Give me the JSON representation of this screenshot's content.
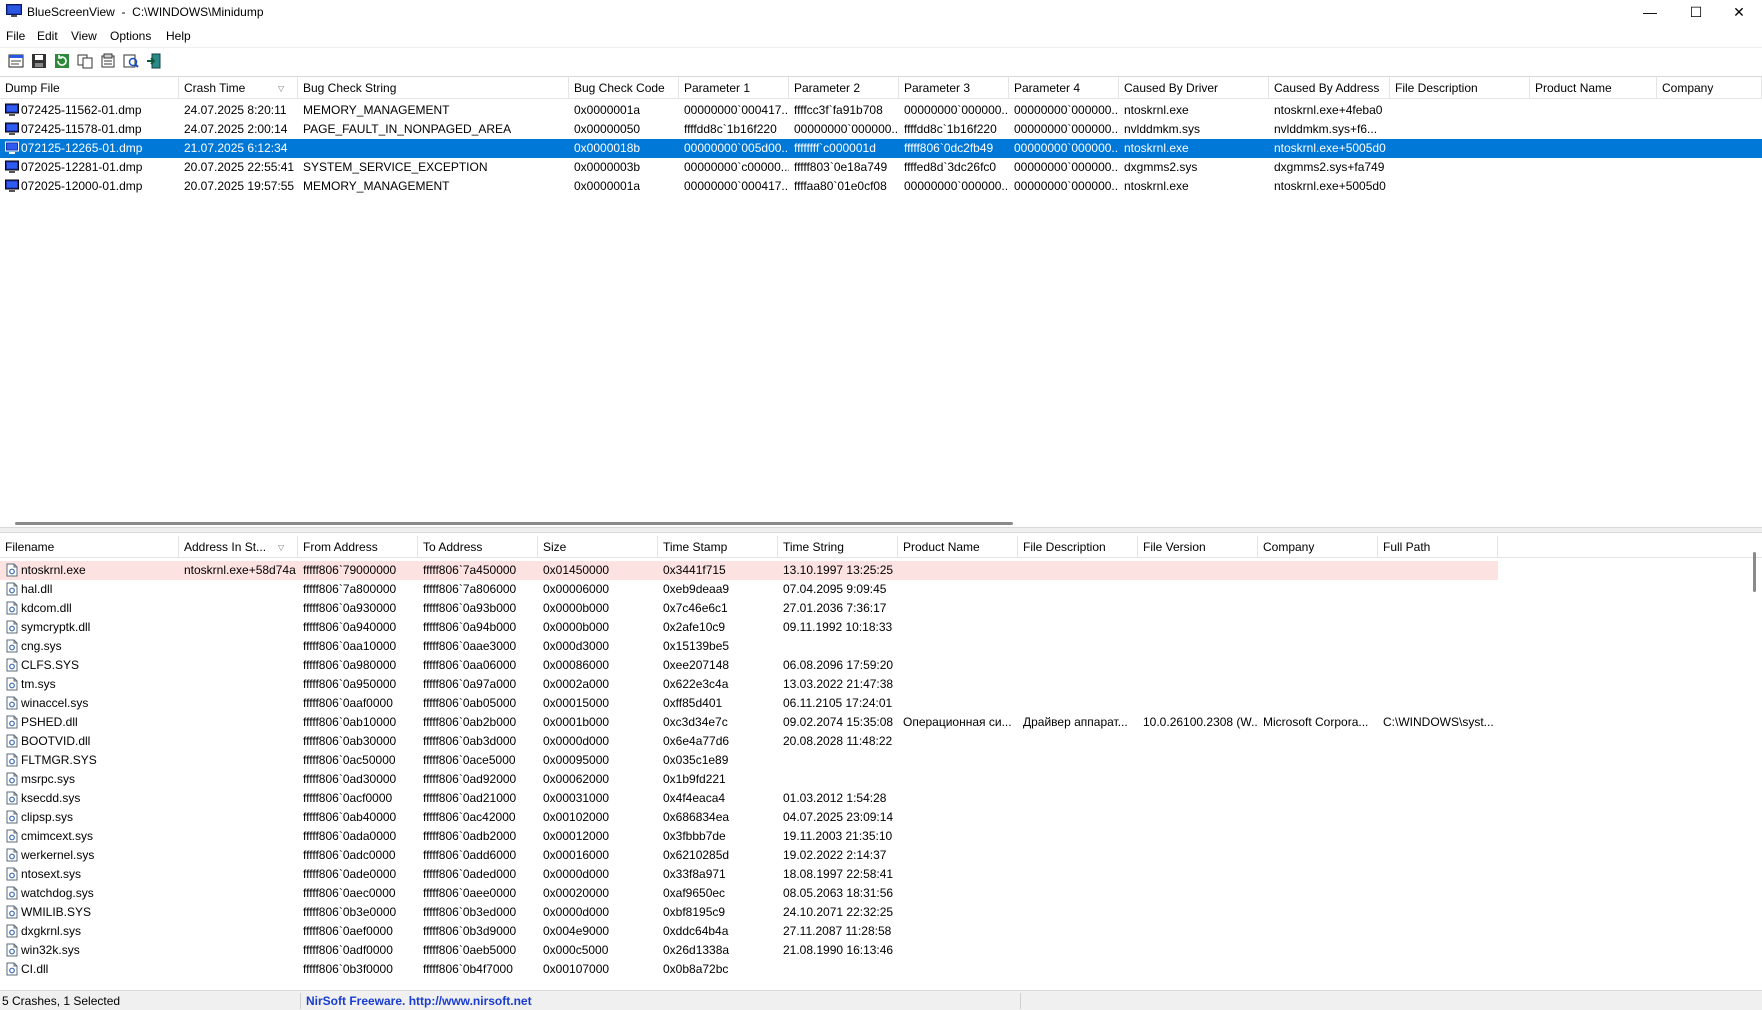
{
  "window": {
    "title": "BlueScreenView  -  C:\\WINDOWS\\Minidump",
    "minimize_glyph": "—",
    "maximize_glyph": "☐",
    "close_glyph": "✕"
  },
  "menu": [
    "File",
    "Edit",
    "View",
    "Options",
    "Help"
  ],
  "toolbar": [
    "html-report-icon",
    "save-icon",
    "refresh-icon",
    "copy-icon",
    "properties-icon",
    "find-icon",
    "exit-icon"
  ],
  "top_table": {
    "headers": [
      "Dump File",
      "Crash Time",
      "Bug Check String",
      "Bug Check Code",
      "Parameter 1",
      "Parameter 2",
      "Parameter 3",
      "Parameter 4",
      "Caused By Driver",
      "Caused By Address",
      "File Description",
      "Product Name",
      "Company"
    ],
    "rows": [
      [
        "072425-11562-01.dmp",
        "24.07.2025 8:20:11",
        "MEMORY_MANAGEMENT",
        "0x0000001a",
        "00000000`000417...",
        "ffffcc3f`fa91b708",
        "00000000`000000...",
        "00000000`000000...",
        "ntoskrnl.exe",
        "ntoskrnl.exe+4feba0",
        "",
        "",
        ""
      ],
      [
        "072425-11578-01.dmp",
        "24.07.2025 2:00:14",
        "PAGE_FAULT_IN_NONPAGED_AREA",
        "0x00000050",
        "ffffdd8c`1b16f220",
        "00000000`000000...",
        "ffffdd8c`1b16f220",
        "00000000`000000...",
        "nvlddmkm.sys",
        "nvlddmkm.sys+f6...",
        "",
        "",
        ""
      ],
      [
        "072125-12265-01.dmp",
        "21.07.2025 6:12:34",
        "",
        "0x0000018b",
        "00000000`005d00...",
        "ffffffff`c000001d",
        "fffff806`0dc2fb49",
        "00000000`000000...",
        "ntoskrnl.exe",
        "ntoskrnl.exe+5005d0",
        "",
        "",
        ""
      ],
      [
        "072025-12281-01.dmp",
        "20.07.2025 22:55:41",
        "SYSTEM_SERVICE_EXCEPTION",
        "0x0000003b",
        "00000000`c00000...",
        "fffff803`0e18a749",
        "ffffed8d`3dc26fc0",
        "00000000`000000...",
        "dxgmms2.sys",
        "dxgmms2.sys+fa749",
        "",
        "",
        ""
      ],
      [
        "072025-12000-01.dmp",
        "20.07.2025 19:57:55",
        "MEMORY_MANAGEMENT",
        "0x0000001a",
        "00000000`000417...",
        "ffffaa80`01e0cf08",
        "00000000`000000...",
        "00000000`000000...",
        "ntoskrnl.exe",
        "ntoskrnl.exe+5005d0",
        "",
        "",
        ""
      ]
    ],
    "selected_row": 2
  },
  "bottom_table": {
    "headers": [
      "Filename",
      "Address In St...",
      "From Address",
      "To Address",
      "Size",
      "Time Stamp",
      "Time String",
      "Product Name",
      "File Description",
      "File Version",
      "Company",
      "Full Path"
    ],
    "rows": [
      [
        "ntoskrnl.exe",
        "ntoskrnl.exe+58d74a",
        "fffff806`79000000",
        "fffff806`7a450000",
        "0x01450000",
        "0x3441f715",
        "13.10.1997 13:25:25",
        "",
        "",
        "",
        "",
        ""
      ],
      [
        "hal.dll",
        "",
        "fffff806`7a800000",
        "fffff806`7a806000",
        "0x00006000",
        "0xeb9deaa9",
        "07.04.2095 9:09:45",
        "",
        "",
        "",
        "",
        ""
      ],
      [
        "kdcom.dll",
        "",
        "fffff806`0a930000",
        "fffff806`0a93b000",
        "0x0000b000",
        "0x7c46e6c1",
        "27.01.2036 7:36:17",
        "",
        "",
        "",
        "",
        ""
      ],
      [
        "symcryptk.dll",
        "",
        "fffff806`0a940000",
        "fffff806`0a94b000",
        "0x0000b000",
        "0x2afe10c9",
        "09.11.1992 10:18:33",
        "",
        "",
        "",
        "",
        ""
      ],
      [
        "cng.sys",
        "",
        "fffff806`0aa10000",
        "fffff806`0aae3000",
        "0x000d3000",
        "0x15139be5",
        "",
        "",
        "",
        "",
        "",
        ""
      ],
      [
        "CLFS.SYS",
        "",
        "fffff806`0a980000",
        "fffff806`0aa06000",
        "0x00086000",
        "0xee207148",
        "06.08.2096 17:59:20",
        "",
        "",
        "",
        "",
        ""
      ],
      [
        "tm.sys",
        "",
        "fffff806`0a950000",
        "fffff806`0a97a000",
        "0x0002a000",
        "0x622e3c4a",
        "13.03.2022 21:47:38",
        "",
        "",
        "",
        "",
        ""
      ],
      [
        "winaccel.sys",
        "",
        "fffff806`0aaf0000",
        "fffff806`0ab05000",
        "0x00015000",
        "0xff85d401",
        "06.11.2105 17:24:01",
        "",
        "",
        "",
        "",
        ""
      ],
      [
        "PSHED.dll",
        "",
        "fffff806`0ab10000",
        "fffff806`0ab2b000",
        "0x0001b000",
        "0xc3d34e7c",
        "09.02.2074 15:35:08",
        "Операционная си...",
        "Драйвер аппарат...",
        "10.0.26100.2308 (W...",
        "Microsoft Corpora...",
        "C:\\WINDOWS\\syst..."
      ],
      [
        "BOOTVID.dll",
        "",
        "fffff806`0ab30000",
        "fffff806`0ab3d000",
        "0x0000d000",
        "0x6e4a77d6",
        "20.08.2028 11:48:22",
        "",
        "",
        "",
        "",
        ""
      ],
      [
        "FLTMGR.SYS",
        "",
        "fffff806`0ac50000",
        "fffff806`0ace5000",
        "0x00095000",
        "0x035c1e89",
        "",
        "",
        "",
        "",
        "",
        ""
      ],
      [
        "msrpc.sys",
        "",
        "fffff806`0ad30000",
        "fffff806`0ad92000",
        "0x00062000",
        "0x1b9fd221",
        "",
        "",
        "",
        "",
        "",
        ""
      ],
      [
        "ksecdd.sys",
        "",
        "fffff806`0acf0000",
        "fffff806`0ad21000",
        "0x00031000",
        "0x4f4eaca4",
        "01.03.2012 1:54:28",
        "",
        "",
        "",
        "",
        ""
      ],
      [
        "clipsp.sys",
        "",
        "fffff806`0ab40000",
        "fffff806`0ac42000",
        "0x00102000",
        "0x686834ea",
        "04.07.2025 23:09:14",
        "",
        "",
        "",
        "",
        ""
      ],
      [
        "cmimcext.sys",
        "",
        "fffff806`0ada0000",
        "fffff806`0adb2000",
        "0x00012000",
        "0x3fbbb7de",
        "19.11.2003 21:35:10",
        "",
        "",
        "",
        "",
        ""
      ],
      [
        "werkernel.sys",
        "",
        "fffff806`0adc0000",
        "fffff806`0add6000",
        "0x00016000",
        "0x6210285d",
        "19.02.2022 2:14:37",
        "",
        "",
        "",
        "",
        ""
      ],
      [
        "ntosext.sys",
        "",
        "fffff806`0ade0000",
        "fffff806`0aded000",
        "0x0000d000",
        "0x33f8a971",
        "18.08.1997 22:58:41",
        "",
        "",
        "",
        "",
        ""
      ],
      [
        "watchdog.sys",
        "",
        "fffff806`0aec0000",
        "fffff806`0aee0000",
        "0x00020000",
        "0xaf9650ec",
        "08.05.2063 18:31:56",
        "",
        "",
        "",
        "",
        ""
      ],
      [
        "WMILIB.SYS",
        "",
        "fffff806`0b3e0000",
        "fffff806`0b3ed000",
        "0x0000d000",
        "0xbf8195c9",
        "24.10.2071 22:32:25",
        "",
        "",
        "",
        "",
        ""
      ],
      [
        "dxgkrnl.sys",
        "",
        "fffff806`0aef0000",
        "fffff806`0b3d9000",
        "0x004e9000",
        "0xddc64b4a",
        "27.11.2087 11:28:58",
        "",
        "",
        "",
        "",
        ""
      ],
      [
        "win32k.sys",
        "",
        "fffff806`0adf0000",
        "fffff806`0aeb5000",
        "0x000c5000",
        "0x26d1338a",
        "21.08.1990 16:13:46",
        "",
        "",
        "",
        "",
        ""
      ],
      [
        "CI.dll",
        "",
        "fffff806`0b3f0000",
        "fffff806`0b4f7000",
        "0x00107000",
        "0x0b8a72bc",
        "",
        "",
        "",
        "",
        "",
        ""
      ]
    ],
    "highlight_row": 0
  },
  "status": {
    "summary": "5 Crashes, 1 Selected",
    "link": "NirSoft Freeware.  http://www.nirsoft.net"
  },
  "colors": {
    "selection": "#0078d7",
    "highlight": "#fde2e2",
    "link": "#1a3cd0"
  }
}
